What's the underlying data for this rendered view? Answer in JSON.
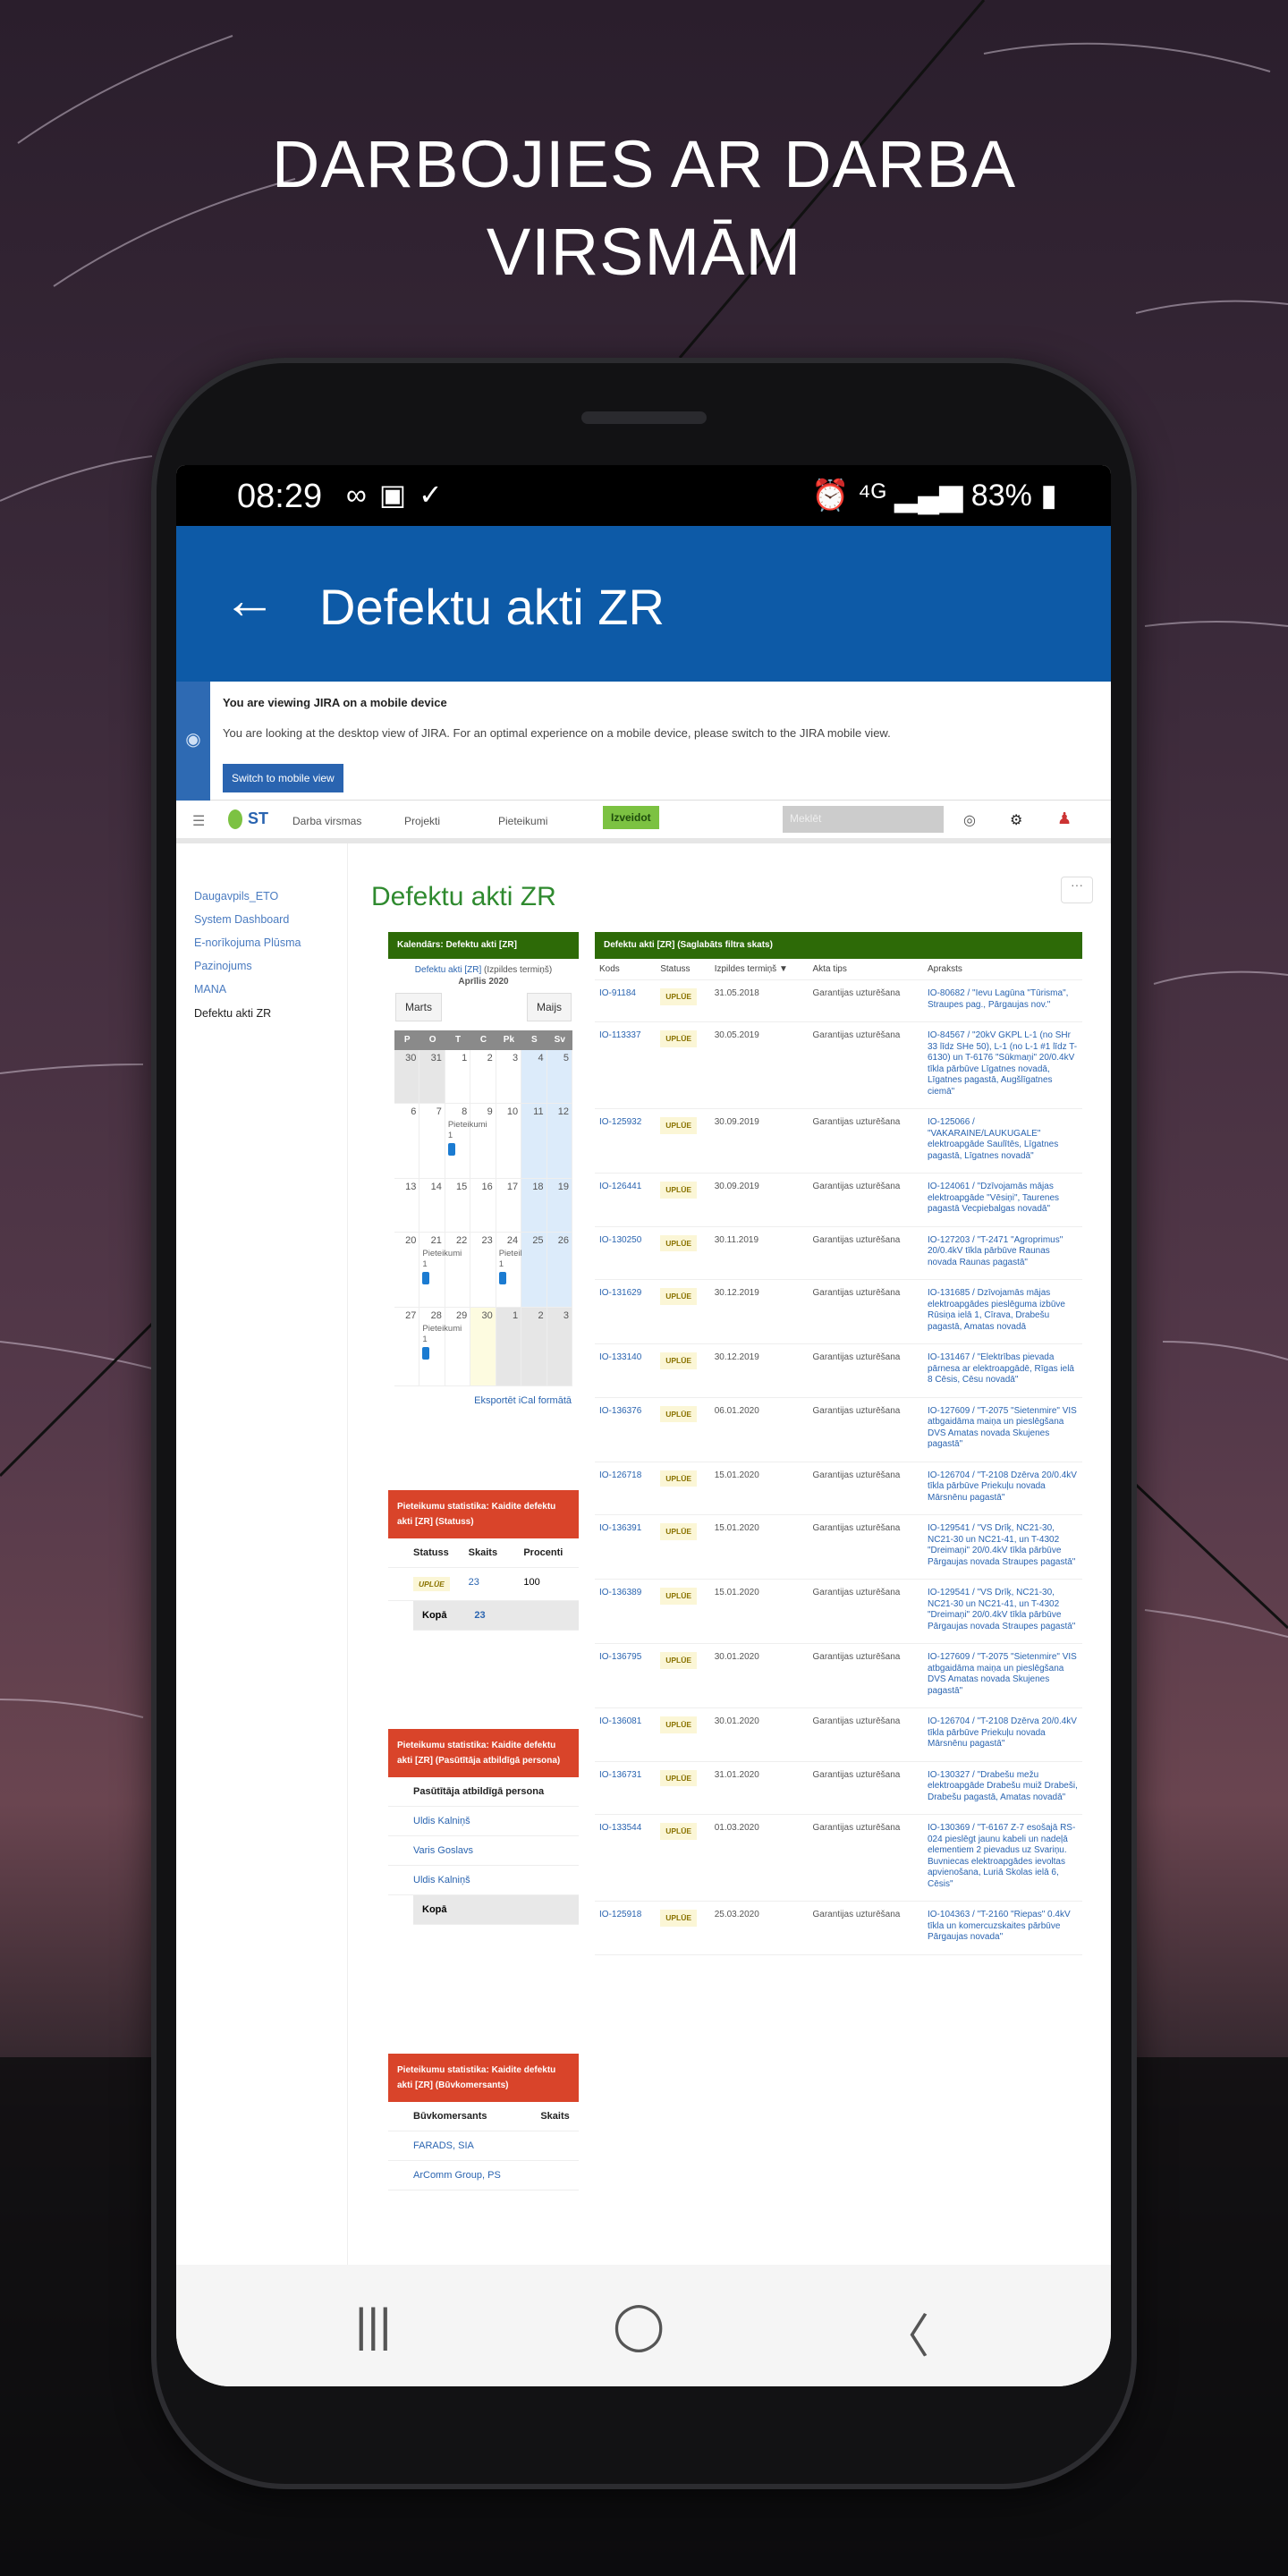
{
  "headline": {
    "line1": "DARBOJIES AR DARBA",
    "line2": "VIRSMĀM"
  },
  "status_bar": {
    "time": "08:29",
    "left_icons": [
      "link-icon",
      "image-icon",
      "check-circle-icon"
    ],
    "right_text": "⏰ ⁴ᴳ ▂▄▆ 83% ▮",
    "battery": "83%"
  },
  "app_bar": {
    "back_icon": "←",
    "title": "Defektu akti ZR"
  },
  "banner": {
    "heading": "You are viewing JIRA on a mobile device",
    "text": "You are looking at the desktop view of JIRA. For an optimal experience on a mobile device, please switch to the JIRA mobile view.",
    "button": "Switch to mobile view"
  },
  "nav": {
    "logo": "ST",
    "items": [
      "Darba virsmas",
      "Projekti",
      "Pieteikumi"
    ],
    "active": "Izveidot",
    "search_placeholder": "Meklēt"
  },
  "sidebar": {
    "items": [
      "Daugavpils_ETO",
      "System Dashboard",
      "E-norīkojuma Plūsma",
      "Pazinojums",
      "MANA"
    ],
    "current": "Defektu akti ZR"
  },
  "page_title": "Defektu akti ZR",
  "calendar": {
    "header": "Kalendārs: Defektu akti [ZR]",
    "filter_link": "Defektu akti [ZR]",
    "filter_text": "(Izpildes termiņš)",
    "month": "Aprīlis 2020",
    "prev": "Marts",
    "next": "Maijs",
    "weekdays": [
      "P",
      "O",
      "T",
      "C",
      "Pk",
      "S",
      "Sv"
    ],
    "weeks": [
      [
        "30",
        "31",
        "1",
        "2",
        "3",
        "4",
        "5"
      ],
      [
        "6",
        "7",
        "8",
        "9",
        "10",
        "11",
        "12"
      ],
      [
        "13",
        "14",
        "15",
        "16",
        "17",
        "18",
        "19"
      ],
      [
        "20",
        "21",
        "22",
        "23",
        "24",
        "25",
        "26"
      ],
      [
        "27",
        "28",
        "29",
        "30",
        "1",
        "2",
        "3"
      ]
    ],
    "event_label": "Pieteikumi",
    "event_count": "1",
    "ical": "Eksportēt iCal formātā"
  },
  "stats_status": {
    "header": "Pieteikumu statistika: Kaidite defektu akti [ZR] (Statuss)",
    "columns": [
      "Statuss",
      "Skaits",
      "Procenti"
    ],
    "rows": [
      {
        "status": "UPLŪE",
        "count": "23",
        "percent": "100"
      }
    ],
    "total_label": "Kopā",
    "total": "23"
  },
  "stats_person": {
    "header": "Pieteikumu statistika: Kaidite defektu akti [ZR] (Pasūtītāja atbildīgā persona)",
    "column": "Pasūtītāja atbildīgā persona",
    "rows": [
      "Uldis Kalniņš",
      "Varis Goslavs",
      "Uldis Kalniņš"
    ],
    "total_label": "Kopā"
  },
  "stats_contractor": {
    "header": "Pieteikumu statistika: Kaidite defektu akti [ZR] (Būvkomersants)",
    "columns": [
      "Būvkomersants",
      "Skaits"
    ],
    "rows": [
      "FARADS, SIA",
      "ArComm Group, PS"
    ]
  },
  "table": {
    "header": "Defektu akti [ZR] (Saglabāts filtra skats)",
    "columns": [
      "Kods",
      "Statuss",
      "Izpildes termiņš ▼",
      "Akta tips",
      "Apraksts"
    ],
    "rows": [
      {
        "id": "IO-91184",
        "status": "UPLŪE",
        "date": "31.05.2018",
        "type": "Garantijas uzturēšana",
        "desc": "IO-80682 / \"Ievu Lagūna \"Tūrisma\", Straupes pag., Pārgaujas nov.\""
      },
      {
        "id": "IO-113337",
        "status": "UPLŪE",
        "date": "30.05.2019",
        "type": "Garantijas uzturēšana",
        "desc": "IO-84567 / \"20kV GKPL L-1 (no SHr 33 līdz SHe 50), L-1 (no L-1 #1 līdz T-6130) un T-6176 \"Sūkmaņi\" 20/0.4kV tīkla pārbūve Līgatnes novadā, Līgatnes pagastā, Augšlīgatnes ciemā\""
      },
      {
        "id": "IO-125932",
        "status": "UPLŪE",
        "date": "30.09.2019",
        "type": "Garantijas uzturēšana",
        "desc": "IO-125066 / \"VAKARAINE/LAUKUGALE\" elektroapgāde Saulītēs, Līgatnes pagastā, Līgatnes novadā\""
      },
      {
        "id": "IO-126441",
        "status": "UPLŪE",
        "date": "30.09.2019",
        "type": "Garantijas uzturēšana",
        "desc": "IO-124061 / \"Dzīvojamās mājas elektroapgāde \"Vēsiņi\", Taurenes pagastā Vecpiebalgas novadā\""
      },
      {
        "id": "IO-130250",
        "status": "UPLŪE",
        "date": "30.11.2019",
        "type": "Garantijas uzturēšana",
        "desc": "IO-127203 / \"T-2471 \"Agroprimus\" 20/0.4kV tīkla pārbūve Raunas novada Raunas pagastā\""
      },
      {
        "id": "IO-131629",
        "status": "UPLŪE",
        "date": "30.12.2019",
        "type": "Garantijas uzturēšana",
        "desc": "IO-131685 / Dzīvojamās mājas elektroapgādes pieslēguma izbūve Rūsiņa ielā 1, Cīrava, Drabešu pagastā, Amatas novadā"
      },
      {
        "id": "IO-133140",
        "status": "UPLŪE",
        "date": "30.12.2019",
        "type": "Garantijas uzturēšana",
        "desc": "IO-131467 / \"Elektrības pievada pārnesa ar elektroapgādē, Rīgas ielā 8 Cēsis, Cēsu novadā\""
      },
      {
        "id": "IO-136376",
        "status": "UPLŪE",
        "date": "06.01.2020",
        "type": "Garantijas uzturēšana",
        "desc": "IO-127609 / \"T-2075 \"Sietenmire\" VIS atbgaidāma maiņa un pieslēgšana DVS Amatas novada Skujenes pagastā\""
      },
      {
        "id": "IO-126718",
        "status": "UPLŪE",
        "date": "15.01.2020",
        "type": "Garantijas uzturēšana",
        "desc": "IO-126704 / \"T-2108 Dzērva 20/0.4kV tīkla pārbūve Priekuļu novada Mārsnēnu pagastā\""
      },
      {
        "id": "IO-136391",
        "status": "UPLŪE",
        "date": "15.01.2020",
        "type": "Garantijas uzturēšana",
        "desc": "IO-129541 / \"VS Drīķ, NC21-30, NC21-30 un NC21-41, un T-4302 \"Dreimaņi\" 20/0.4kV tīkla pārbūve Pārgaujas novada Straupes pagastā\""
      },
      {
        "id": "IO-136389",
        "status": "UPLŪE",
        "date": "15.01.2020",
        "type": "Garantijas uzturēšana",
        "desc": "IO-129541 / \"VS Drīķ, NC21-30, NC21-30 un NC21-41, un T-4302 \"Dreimaņi\" 20/0.4kV tīkla pārbūve Pārgaujas novada Straupes pagastā\""
      },
      {
        "id": "IO-136795",
        "status": "UPLŪE",
        "date": "30.01.2020",
        "type": "Garantijas uzturēšana",
        "desc": "IO-127609 / \"T-2075 \"Sietenmire\" VIS atbgaidāma maiņa un pieslēgšana DVS Amatas novada Skujenes pagastā\""
      },
      {
        "id": "IO-136081",
        "status": "UPLŪE",
        "date": "30.01.2020",
        "type": "Garantijas uzturēšana",
        "desc": "IO-126704 / \"T-2108 Dzērva 20/0.4kV tīkla pārbūve Priekuļu novada Mārsnēnu pagastā\""
      },
      {
        "id": "IO-136731",
        "status": "UPLŪE",
        "date": "31.01.2020",
        "type": "Garantijas uzturēšana",
        "desc": "IO-130327 / \"Drabešu mežu elektroapgāde Drabešu muiž Drabeši, Drabešu pagastā, Amatas novadā\""
      },
      {
        "id": "IO-133544",
        "status": "UPLŪE",
        "date": "01.03.2020",
        "type": "Garantijas uzturēšana",
        "desc": "IO-130369 / \"T-6167 Z-7 esošajā RS-024 pieslēgt jaunu kabeli un nadeļā elementiem 2 pievadus uz Svariņu. Buvniecas elektroapgādes ievoltas apvienošana, Luriā Skolas ielā 6, Cēsis\""
      },
      {
        "id": "IO-125918",
        "status": "UPLŪE",
        "date": "25.03.2020",
        "type": "Garantijas uzturēšana",
        "desc": "IO-104363 / \"T-2160 \"Riepas\" 0.4kV tīkla un komercuzskaites pārbūve Pārgaujas novada\""
      }
    ]
  },
  "android_nav": {
    "recents": "|||",
    "home": "◯",
    "back": "〈"
  }
}
